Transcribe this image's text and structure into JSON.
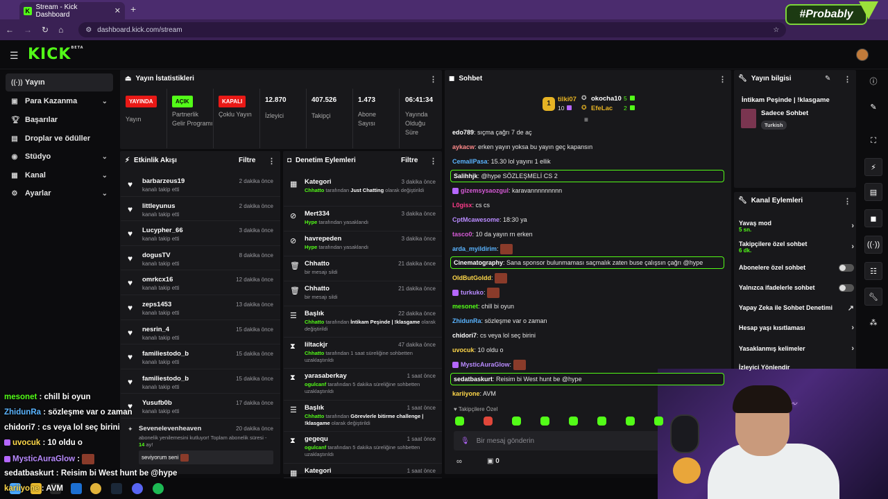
{
  "browser": {
    "tab_title": "Stream - Kick Dashboard",
    "url": "dashboard.kick.com/stream",
    "brand_overlay": "#Probably"
  },
  "header": {
    "logo": "KICK",
    "logo_beta": "BETA"
  },
  "sidebar": {
    "items": [
      {
        "label": "Yayın",
        "icon": "broadcast-icon"
      },
      {
        "label": "Para Kazanma",
        "icon": "wallet-icon"
      },
      {
        "label": "Başarılar",
        "icon": "trophy-icon"
      },
      {
        "label": "Droplar ve ödüller",
        "icon": "gift-icon"
      },
      {
        "label": "Stüdyo",
        "icon": "studio-icon"
      },
      {
        "label": "Kanal",
        "icon": "channel-icon"
      },
      {
        "label": "Ayarlar",
        "icon": "gear-icon"
      }
    ]
  },
  "stats": {
    "title": "Yayın İstatistikleri",
    "cols": [
      {
        "badge": "YAYINDA",
        "badge_color": "#e91916",
        "label": "Yayın"
      },
      {
        "badge": "AÇIK",
        "badge_color": "#53fc18",
        "label": "Partnerlik Gelir Programı"
      },
      {
        "badge": "KAPALI",
        "badge_color": "#e91916",
        "label": "Çoklu Yayın"
      },
      {
        "value": "12.870",
        "label": "İzleyici"
      },
      {
        "value": "407.526",
        "label": "Takipçi"
      },
      {
        "value": "1.473",
        "label": "Abone Sayısı"
      },
      {
        "value": "06:41:34",
        "label": "Yayında Olduğu Süre"
      }
    ]
  },
  "events": {
    "title": "Etkinlik Akışı",
    "filter": "Filtre",
    "rows": [
      {
        "name": "barbarzeus19",
        "sub": "kanalı takip etti",
        "time": "2 dakika önce"
      },
      {
        "name": "littleyunus",
        "sub": "kanalı takip etti",
        "time": "2 dakika önce"
      },
      {
        "name": "Lucypher_66",
        "sub": "kanalı takip etti",
        "time": "3 dakika önce"
      },
      {
        "name": "dogusTV",
        "sub": "kanalı takip etti",
        "time": "8 dakika önce"
      },
      {
        "name": "omrkcx16",
        "sub": "kanalı takip etti",
        "time": "12 dakika önce"
      },
      {
        "name": "zeps1453",
        "sub": "kanalı takip etti",
        "time": "13 dakika önce"
      },
      {
        "name": "nesrin_4",
        "sub": "kanalı takip etti",
        "time": "15 dakika önce"
      },
      {
        "name": "familiestodo_b",
        "sub": "kanalı takip etti",
        "time": "15 dakika önce"
      },
      {
        "name": "familiestodo_b",
        "sub": "kanalı takip etti",
        "time": "15 dakika önce"
      },
      {
        "name": "Yusufb0b",
        "sub": "kanalı takip etti",
        "time": "17 dakika önce"
      }
    ],
    "sub_event": {
      "name": "Sevenelevenheaven",
      "time": "20 dakika önce",
      "text": "abonelik yenilemesini kutluyor! Toplam abonelik süresi - ",
      "months": "14",
      "months_suffix": " ay!",
      "message": "seviyorum seni"
    }
  },
  "mod": {
    "title": "Denetim Eylemleri",
    "filter": "Filtre",
    "rows": [
      {
        "icon": "category-icon",
        "name": "Kategori",
        "time": "3 dakika önce",
        "actor": "Chhatto",
        "mid": " tarafından ",
        "hl": "Just Chatting",
        "tail": " olarak değiştirildi"
      },
      {
        "icon": "ban-icon",
        "name": "Mert334",
        "time": "3 dakika önce",
        "actor": "Hype",
        "mid": " tarafından yasaklandı",
        "hl": "",
        "tail": ""
      },
      {
        "icon": "ban-icon",
        "name": "havrepeden",
        "time": "3 dakika önce",
        "actor": "Hype",
        "mid": " tarafından yasaklandı",
        "hl": "",
        "tail": ""
      },
      {
        "icon": "trash-icon",
        "name": "Chhatto",
        "time": "21 dakika önce",
        "actor": "",
        "mid": "bir mesajı sildi",
        "hl": "",
        "tail": ""
      },
      {
        "icon": "trash-icon",
        "name": "Chhatto",
        "time": "21 dakika önce",
        "actor": "",
        "mid": "bir mesajı sildi",
        "hl": "",
        "tail": ""
      },
      {
        "icon": "title-icon",
        "name": "Başlık",
        "time": "22 dakika önce",
        "actor": "Chhatto",
        "mid": " tarafından ",
        "hl": "İntikam Peşinde | !klasgame",
        "tail": " olarak değiştirildi"
      },
      {
        "icon": "hourglass-icon",
        "name": "liltackjr",
        "time": "47 dakika önce",
        "actor": "Chhatto",
        "mid": " tarafından 1 saat süreliğine sohbetten uzaklaştırıldı",
        "hl": "",
        "tail": ""
      },
      {
        "icon": "hourglass-icon",
        "name": "yarasaberkay",
        "time": "1 saat önce",
        "actor": "ogulcanf",
        "mid": " tarafından 5 dakika süreliğine sohbetten uzaklaştırıldı",
        "hl": "",
        "tail": ""
      },
      {
        "icon": "title-icon",
        "name": "Başlık",
        "time": "1 saat önce",
        "actor": "Chhatto",
        "mid": " tarafından ",
        "hl": "Görevlerle bitirme challenge | !klasgame",
        "tail": " olarak değiştirildi"
      },
      {
        "icon": "hourglass-icon",
        "name": "gegequ",
        "time": "1 saat önce",
        "actor": "ogulcanf",
        "mid": " tarafından 5 dakika süreliğine sohbetten uzaklaştırıldı",
        "hl": "",
        "tail": ""
      },
      {
        "icon": "category-icon",
        "name": "Kategori",
        "time": "1 saat önce",
        "actor": "",
        "mid": "",
        "hl": "",
        "tail": ""
      }
    ]
  },
  "chat": {
    "title": "Sohbet",
    "leaders": [
      {
        "name": "tilki07",
        "count": "10"
      },
      {
        "name": "okocha10",
        "count": "5"
      },
      {
        "name": "EfeLac",
        "count": "2"
      }
    ],
    "rank": "1",
    "messages": [
      {
        "user": "edo789",
        "color": "#ffffff",
        "text": "sıçma çağrı 7 de aç",
        "hl": false,
        "emote": false
      },
      {
        "user": "aykacw",
        "color": "#ff8a8a",
        "text": "erken yayın yoksa bu yayın geç kapansın",
        "hl": false,
        "emote": false
      },
      {
        "user": "CemallPasa",
        "color": "#5ab4ff",
        "text": "15.30 lol yayını 1 ellik",
        "hl": false,
        "emote": false
      },
      {
        "user": "Salihhjk",
        "color": "#ffffff",
        "text": "@hype SÖZLEŞMELİ CS 2",
        "hl": true,
        "emote": false
      },
      {
        "user": "gizemsysaozgul",
        "color": "#d65ad6",
        "text": "karavannnnnnnnn",
        "hl": false,
        "emote": false
      },
      {
        "user": "L0gisx",
        "color": "#ff3b8a",
        "text": "cs cs",
        "hl": false,
        "emote": false
      },
      {
        "user": "CptMcawesome",
        "color": "#b98bff",
        "text": "18:30 ya",
        "hl": false,
        "emote": false
      },
      {
        "user": "tasco0",
        "color": "#d65ad6",
        "text": "10 da yayın rn erken",
        "hl": false,
        "emote": false
      },
      {
        "user": "arda_myildirim",
        "color": "#5ab4ff",
        "text": "",
        "hl": false,
        "emote": true
      },
      {
        "user": "Cinematography",
        "color": "#ffffff",
        "text": "Sana sponsor bulunmaması saçmalık zaten buse çalışsın çağrı @hype",
        "hl": true,
        "emote": false
      },
      {
        "user": "OldButGoldd",
        "color": "#ffd84a",
        "text": "",
        "hl": false,
        "emote": true
      },
      {
        "user": "turkuko",
        "color": "#b98bff",
        "text": "",
        "hl": false,
        "emote": true
      },
      {
        "user": "mesonet",
        "color": "#53fc18",
        "text": "chill bi oyun",
        "hl": false,
        "emote": false
      },
      {
        "user": "ZhidunRa",
        "color": "#5ab4ff",
        "text": "sözleşme var o zaman",
        "hl": false,
        "emote": false
      },
      {
        "user": "chidori7",
        "color": "#ffffff",
        "text": "cs veya lol seç birini",
        "hl": false,
        "emote": false
      },
      {
        "user": "uvocuk",
        "color": "#ffd84a",
        "text": "10 oldu o",
        "hl": false,
        "emote": false
      },
      {
        "user": "MysticAuraGlow",
        "color": "#b98bff",
        "text": "",
        "hl": false,
        "emote": true
      },
      {
        "user": "sedatbaskurt",
        "color": "#ffffff",
        "text": "Reisim bi West hunt be @hype",
        "hl": true,
        "emote": false
      },
      {
        "user": "kariiyone",
        "color": "#ffd84a",
        "text": "AVM",
        "hl": false,
        "emote": false
      }
    ],
    "followers_only": "Takipçilere Özel",
    "input_placeholder": "Bir mesaj gönderin",
    "points": "0"
  },
  "stream_info": {
    "title": "Yayın bilgisi",
    "stream_title": "İntikam Peşinde | !klasgame",
    "category": "Sadece Sohbet",
    "language": "Turkish"
  },
  "channel_actions": {
    "title": "Kanal Eylemleri",
    "items": [
      {
        "label": "Yavaş mod",
        "sub": "5 sn.",
        "control": "chevron"
      },
      {
        "label": "Takipçilere özel sohbet",
        "sub": "6 dk.",
        "control": "chevron"
      },
      {
        "label": "Abonelere özel sohbet",
        "sub": "",
        "control": "toggle"
      },
      {
        "label": "Yalnızca ifadelerle sohbet",
        "sub": "",
        "control": "toggle"
      },
      {
        "label": "Yapay Zeka ile Sohbet Denetimi",
        "sub": "",
        "control": "external"
      },
      {
        "label": "Hesap yaşı kısıtlaması",
        "sub": "",
        "control": "chevron"
      },
      {
        "label": "Yasaklanmış kelimeler",
        "sub": "",
        "control": "chevron"
      },
      {
        "label": "İzleyici Yönlendir",
        "sub": "",
        "control": "none"
      }
    ]
  },
  "overlay_chat": [
    {
      "user": "mesonet",
      "color": "#53fc18",
      "text": " : chill bi oyun"
    },
    {
      "user": "ZhidunRa",
      "color": "#5ab4ff",
      "text": " : sözleşme var o zaman"
    },
    {
      "user": "chidori7",
      "color": "#ffffff",
      "text": " : cs veya lol seç birini"
    },
    {
      "user": "uvocuk",
      "color": "#ffd84a",
      "text": " : 10 oldu o"
    },
    {
      "user": "MysticAuraGlow",
      "color": "#b98bff",
      "text": " : "
    },
    {
      "user": "sedatbaskurt",
      "color": "#ffffff",
      "text": " : Reisim bi West hunt be @hype"
    },
    {
      "user": "kariiyone",
      "color": "#ffd84a",
      "text": " : AVM"
    }
  ]
}
